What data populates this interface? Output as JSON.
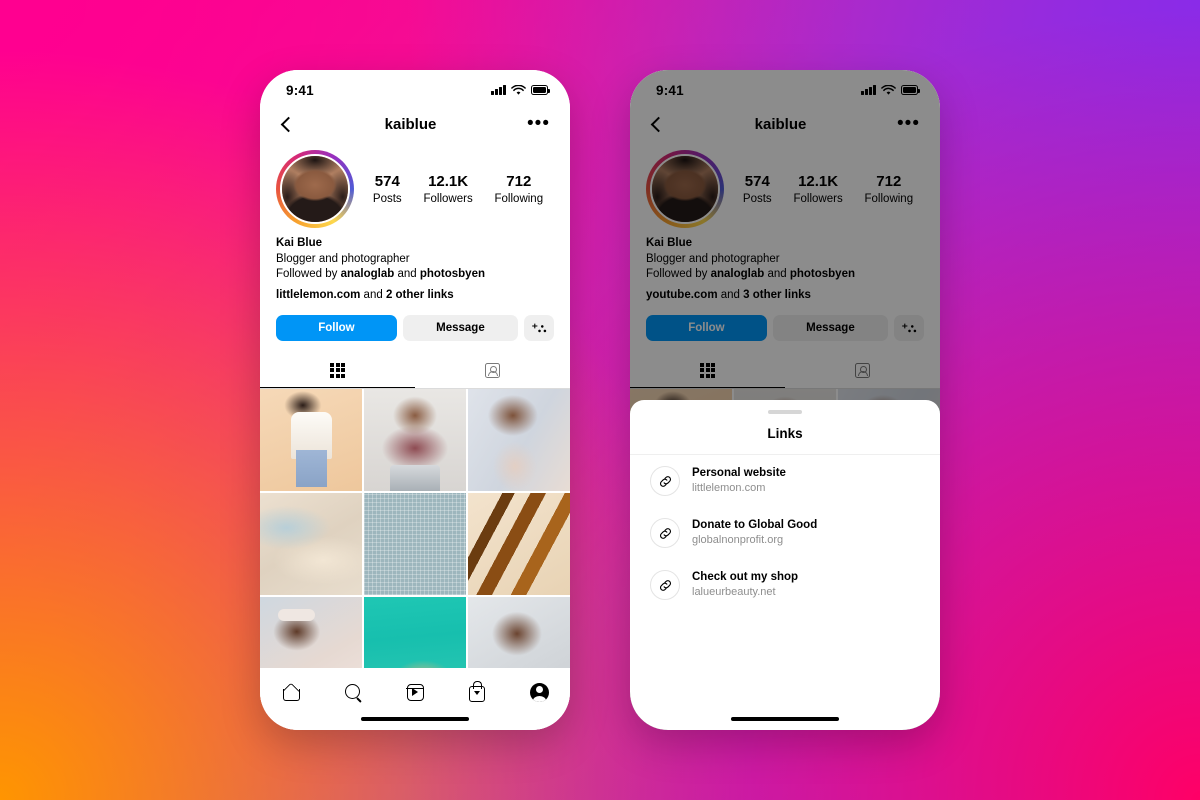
{
  "background": {
    "colors": {
      "top_left": "#ff0090",
      "top_right": "#8a2be8",
      "bottom_left": "#ff9500",
      "bottom_right": "#ff0066"
    }
  },
  "theme": {
    "accent_blue": "#0095f6",
    "button_gray": "#efefef",
    "muted_text": "#8e8e8e",
    "divider": "#dbdbdb"
  },
  "status_bar": {
    "time": "9:41",
    "cellular_icon": "signal-bars-icon",
    "wifi_icon": "wifi-icon",
    "battery_icon": "battery-icon"
  },
  "nav": {
    "back_icon": "back-chevron-icon",
    "title": "kaiblue",
    "more_icon": "more-options-icon",
    "more_glyph": "•••"
  },
  "profile": {
    "avatar_name": "profile-avatar",
    "stats": [
      {
        "value": "574",
        "label": "Posts"
      },
      {
        "value": "12.1K",
        "label": "Followers"
      },
      {
        "value": "712",
        "label": "Following"
      }
    ],
    "display_name": "Kai Blue",
    "bio": "Blogger and photographer",
    "followed_by_prefix": "Followed by ",
    "followed_by_1": "analoglab",
    "followed_by_join": " and ",
    "followed_by_2": "photosbyen"
  },
  "links_line_left": {
    "primary": "littlelemon.com",
    "join": " and ",
    "more": "2 other links"
  },
  "links_line_right": {
    "primary": "youtube.com",
    "join": " and ",
    "more": "3 other links"
  },
  "actions": {
    "follow_label": "Follow",
    "message_label": "Message",
    "add_user_icon": "add-user-icon",
    "add_user_glyph": "⁺⛬"
  },
  "tabs": [
    {
      "name": "grid-tab",
      "icon": "grid-icon",
      "active": true
    },
    {
      "name": "tagged-tab",
      "icon": "tagged-photos-icon",
      "active": false
    }
  ],
  "photo_grid": {
    "count": 9,
    "items": [
      "post-thumbnail-1",
      "post-thumbnail-2",
      "post-thumbnail-3",
      "post-thumbnail-4",
      "post-thumbnail-5",
      "post-thumbnail-6",
      "post-thumbnail-7",
      "post-thumbnail-8",
      "post-thumbnail-9"
    ]
  },
  "bottom_nav": [
    {
      "name": "nav-home",
      "icon": "home-icon"
    },
    {
      "name": "nav-search",
      "icon": "search-icon"
    },
    {
      "name": "nav-reels",
      "icon": "reels-icon"
    },
    {
      "name": "nav-shop",
      "icon": "shop-bag-icon"
    },
    {
      "name": "nav-profile",
      "icon": "profile-avatar-icon"
    }
  ],
  "links_sheet": {
    "handle_icon": "drag-handle-icon",
    "title": "Links",
    "items": [
      {
        "title": "Personal website",
        "url": "littlelemon.com",
        "icon": "link-chain-icon"
      },
      {
        "title": "Donate to Global Good",
        "url": "globalnonprofit.org",
        "icon": "link-chain-icon"
      },
      {
        "title": "Check out my shop",
        "url": "lalueurbeauty.net",
        "icon": "link-chain-icon"
      }
    ]
  }
}
